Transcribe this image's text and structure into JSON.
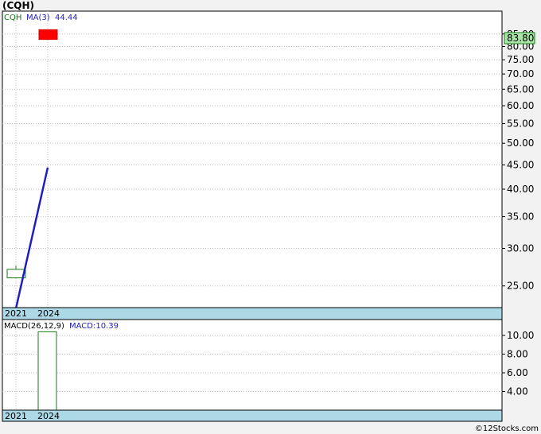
{
  "header": {
    "title": "(CQH)"
  },
  "footer": {
    "credit": "©12Stocks.com"
  },
  "chart_data": [
    {
      "type": "candlestick",
      "panel": "price",
      "scale": "log",
      "ylim": [
        22.5,
        95
      ],
      "y_ticks": [
        "85.00",
        "80.00",
        "75.00",
        "70.00",
        "65.00",
        "60.00",
        "55.00",
        "50.00",
        "45.00",
        "40.00",
        "35.00",
        "30.00",
        "25.00"
      ],
      "x_tick_labels": [
        "2021",
        "2024"
      ],
      "legend": {
        "symbol": "CQH",
        "ma_label": "MA(3)",
        "ma_value": "44.44"
      },
      "last_price_label": "83.80",
      "candles": [
        {
          "x": "2021",
          "open": 26.0,
          "close": 27.1,
          "high": 27.6,
          "low": 26.0,
          "color": "#1a7a1a",
          "fill": "#ffffff"
        },
        {
          "x": "2024",
          "open": 86.8,
          "close": 82.8,
          "high": 86.8,
          "low": 82.8,
          "color": "#e10000",
          "fill": "#ff0000"
        }
      ],
      "series": [
        {
          "name": "MA(3)",
          "color": "#1f1fc0",
          "points": [
            {
              "x": "2021",
              "y": 22.4
            },
            {
              "x": "2024",
              "y": 44.44
            }
          ]
        }
      ],
      "colors": {
        "accent": "#add8e6",
        "grid": "#bdbdbd"
      }
    },
    {
      "type": "bar",
      "panel": "macd",
      "ylim": [
        2.0,
        11.7
      ],
      "y_ticks": [
        "10.00",
        "8.00",
        "6.00",
        "4.00"
      ],
      "x_tick_labels": [
        "2021",
        "2024"
      ],
      "legend": {
        "label": "MACD(26,12,9)",
        "value_label": "MACD:10.39"
      },
      "bars": [
        {
          "x": "2024",
          "value": 10.39
        }
      ],
      "colors": {
        "bar_stroke": "#1a7a1a",
        "legend_text": "#1f1fc0"
      }
    }
  ]
}
